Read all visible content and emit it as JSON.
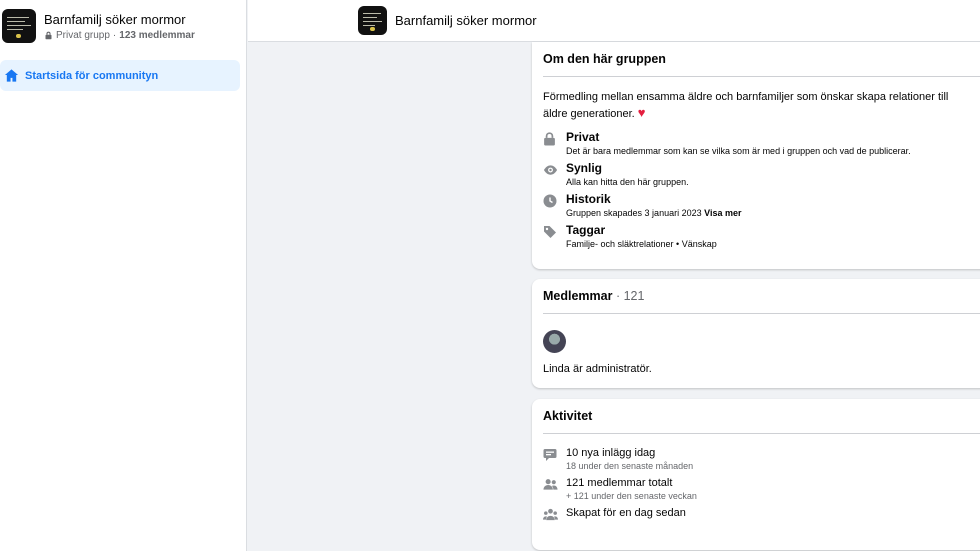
{
  "sidebar": {
    "group_name": "Barnfamilj söker mormor",
    "privacy": "Privat grupp",
    "member_count": "123 medlemmar",
    "nav": [
      {
        "label": "Startsida för communityn"
      }
    ]
  },
  "header": {
    "group_name": "Barnfamilj söker mormor"
  },
  "about": {
    "title": "Om den här gruppen",
    "description": "Förmedling mellan ensamma äldre och barnfamiljer som önskar skapa relationer till äldre generationer.",
    "items": [
      {
        "icon": "lock-icon",
        "title": "Privat",
        "text": "Det är bara medlemmar som kan se vilka som är med i gruppen och vad de publicerar.",
        "link": ""
      },
      {
        "icon": "eye-icon",
        "title": "Synlig",
        "text": "Alla kan hitta den här gruppen.",
        "link": ""
      },
      {
        "icon": "clock-icon",
        "title": "Historik",
        "text": "Gruppen skapades 3 januari 2023",
        "link": "Visa mer"
      },
      {
        "icon": "tag-icon",
        "title": "Taggar",
        "text": "Familje- och släktrelationer • Vänskap",
        "link": ""
      }
    ]
  },
  "members": {
    "title": "Medlemmar",
    "count": " · 121",
    "admin_text": "Linda är administratör."
  },
  "activity": {
    "title": "Aktivitet",
    "items": [
      {
        "icon": "chat-icon",
        "title": "10 nya inlägg idag",
        "sub": "18 under den senaste månaden"
      },
      {
        "icon": "people-icon",
        "title": "121 medlemmar totalt",
        "sub": "+ 121 under den senaste veckan"
      },
      {
        "icon": "group-icon",
        "title": "Skapat för en dag sedan",
        "sub": ""
      }
    ]
  },
  "colors": {
    "accent": "#1877f2",
    "heart": "#e41e3f",
    "icon_gray": "#8a8d91"
  }
}
